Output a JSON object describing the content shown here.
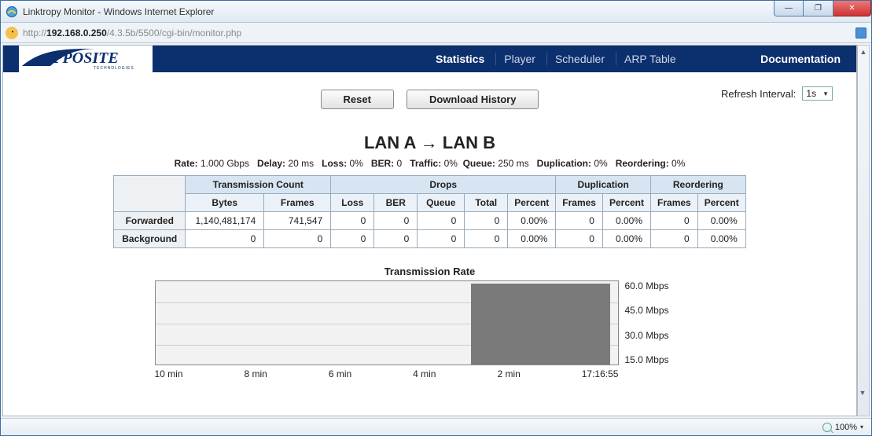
{
  "window": {
    "title": "Linktropy Monitor - Windows Internet Explorer"
  },
  "address": {
    "prefix": "http://",
    "bold": "192.168.0.250",
    "rest": "/4.3.5b/5500/cgi-bin/monitor.php"
  },
  "nav": {
    "logo_main": "APPOSITE",
    "logo_sub": "TECHNOLOGIES",
    "items": [
      "Statistics",
      "Player",
      "Scheduler",
      "ARP Table"
    ],
    "docs": "Documentation"
  },
  "controls": {
    "reset": "Reset",
    "download": "Download History",
    "refresh_label": "Refresh Interval:",
    "refresh_value": "1s"
  },
  "direction_title": "LAN A → LAN B",
  "params": {
    "rate_label": "Rate:",
    "rate_val": "1.000 Gbps",
    "delay_label": "Delay:",
    "delay_val": "20 ms",
    "loss_label": "Loss:",
    "loss_val": "0%",
    "ber_label": "BER:",
    "ber_val": "0",
    "traffic_label": "Traffic:",
    "traffic_val": "0%",
    "queue_label": "Queue:",
    "queue_val": "250 ms",
    "dup_label": "Duplication:",
    "dup_val": "0%",
    "reord_label": "Reordering:",
    "reord_val": "0%"
  },
  "table": {
    "group_headers": {
      "tx": "Transmission Count",
      "drops": "Drops",
      "dup": "Duplication",
      "reord": "Reordering"
    },
    "sub_headers": {
      "bytes": "Bytes",
      "frames": "Frames",
      "loss": "Loss",
      "ber": "BER",
      "queue": "Queue",
      "total": "Total",
      "percent": "Percent",
      "dframes": "Frames",
      "dpercent": "Percent",
      "rframes": "Frames",
      "rpercent": "Percent"
    },
    "rows": [
      {
        "name": "Forwarded",
        "bytes": "1,140,481,174",
        "frames": "741,547",
        "loss": "0",
        "ber": "0",
        "queue": "0",
        "total": "0",
        "percent": "0.00%",
        "dframes": "0",
        "dpercent": "0.00%",
        "rframes": "0",
        "rpercent": "0.00%"
      },
      {
        "name": "Background",
        "bytes": "0",
        "frames": "0",
        "loss": "0",
        "ber": "0",
        "queue": "0",
        "total": "0",
        "percent": "0.00%",
        "dframes": "0",
        "dpercent": "0.00%",
        "rframes": "0",
        "rpercent": "0.00%"
      }
    ]
  },
  "chart_data": {
    "type": "area",
    "title": "Transmission Rate",
    "ylabel": "Mbps",
    "ylim": [
      0,
      60
    ],
    "y_ticks": [
      "60.0 Mbps",
      "45.0 Mbps",
      "30.0 Mbps",
      "15.0 Mbps"
    ],
    "x_ticks": [
      "10 min",
      "8 min",
      "6 min",
      "4 min",
      "2 min",
      "17:16:55"
    ],
    "x_range_minutes": 10,
    "series": [
      {
        "name": "Transmission Rate",
        "x_start_min_ago": 3.2,
        "x_end_min_ago": 0.2,
        "value_mbps": 57
      }
    ]
  },
  "status": {
    "zoom": "100%"
  }
}
